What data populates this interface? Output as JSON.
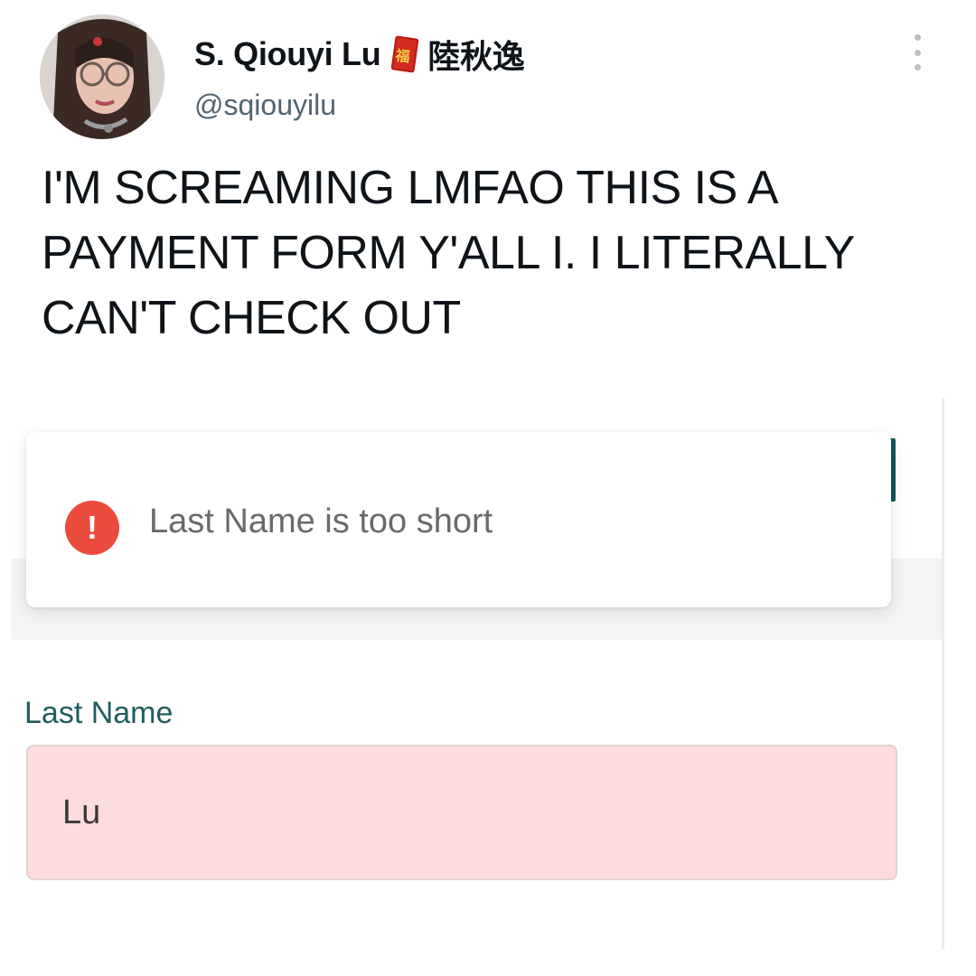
{
  "tweet": {
    "author": {
      "display_name": "S. Qiouyi Lu",
      "name_emoji": "red-envelope-icon",
      "chinese_name": "陸秋逸",
      "handle": "@sqiouyilu"
    },
    "text_lines": [
      "I'M SCREAMING LMFAO THIS IS A",
      "PAYMENT FORM Y'ALL I. I LITERALLY",
      "CAN'T CHECK OUT"
    ]
  },
  "screenshot": {
    "error_toast": {
      "icon": "!",
      "message": "Last Name is too short",
      "icon_color": "#e94c3d"
    },
    "last_name_field": {
      "label": "Last Name",
      "value": "Lu",
      "error_background": "#fcdcdc"
    }
  },
  "colors": {
    "handle_gray": "#536471",
    "label_teal": "#1f5f5e",
    "teal_accent": "#14575a"
  }
}
